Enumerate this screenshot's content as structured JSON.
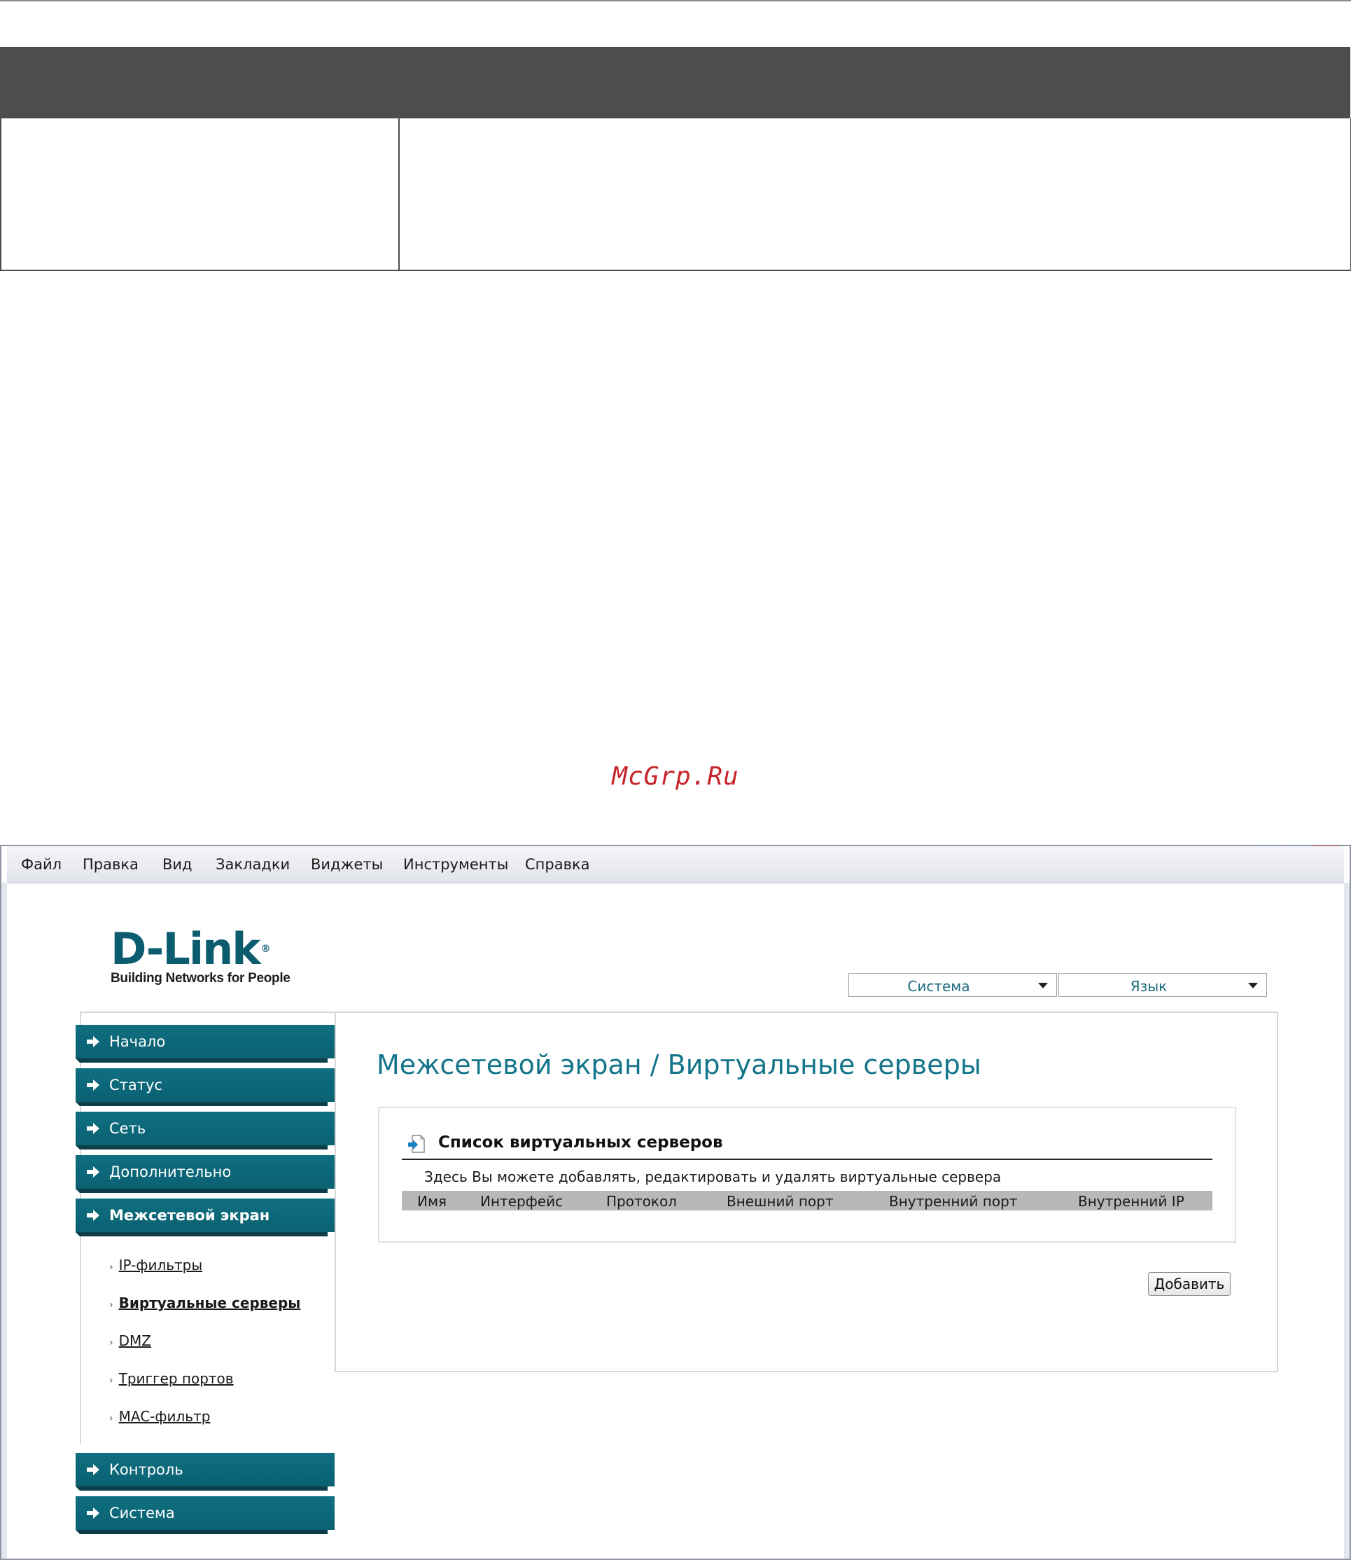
{
  "watermark": "McGrp.Ru",
  "menubar": {
    "items": [
      "Файл",
      "Правка",
      "Вид",
      "Закладки",
      "Виджеты",
      "Инструменты",
      "Справка"
    ]
  },
  "logo": {
    "brand": "D-Link",
    "tagline": "Building Networks for People"
  },
  "selects": {
    "system": "Система",
    "language": "Язык"
  },
  "sidebar": {
    "items": [
      {
        "label": "Начало"
      },
      {
        "label": "Статус"
      },
      {
        "label": "Сеть"
      },
      {
        "label": "Дополнительно"
      },
      {
        "label": "Межсетевой экран"
      },
      {
        "label": "Контроль"
      },
      {
        "label": "Система"
      }
    ],
    "subitems": [
      {
        "label": "IP-фильтры"
      },
      {
        "label": "Виртуальные серверы"
      },
      {
        "label": "DMZ"
      },
      {
        "label": "Триггер портов"
      },
      {
        "label": "MAC-фильтр"
      }
    ]
  },
  "main": {
    "title": "Межсетевой экран /  Виртуальные серверы",
    "panel": {
      "title": "Список виртуальных серверов",
      "description": "Здесь Вы можете добавлять, редактировать и удалять виртуальные сервера",
      "columns": [
        "Имя",
        "Интерфейс",
        "Протокол",
        "Внешний порт",
        "Внутренний порт",
        "Внутренний IP"
      ]
    },
    "add_button": "Добавить"
  },
  "colors": {
    "nav_teal": "#0f6f80",
    "title_teal": "#14758a",
    "watermark_red": "#c8232a",
    "header_dark": "#4d4d4d"
  }
}
